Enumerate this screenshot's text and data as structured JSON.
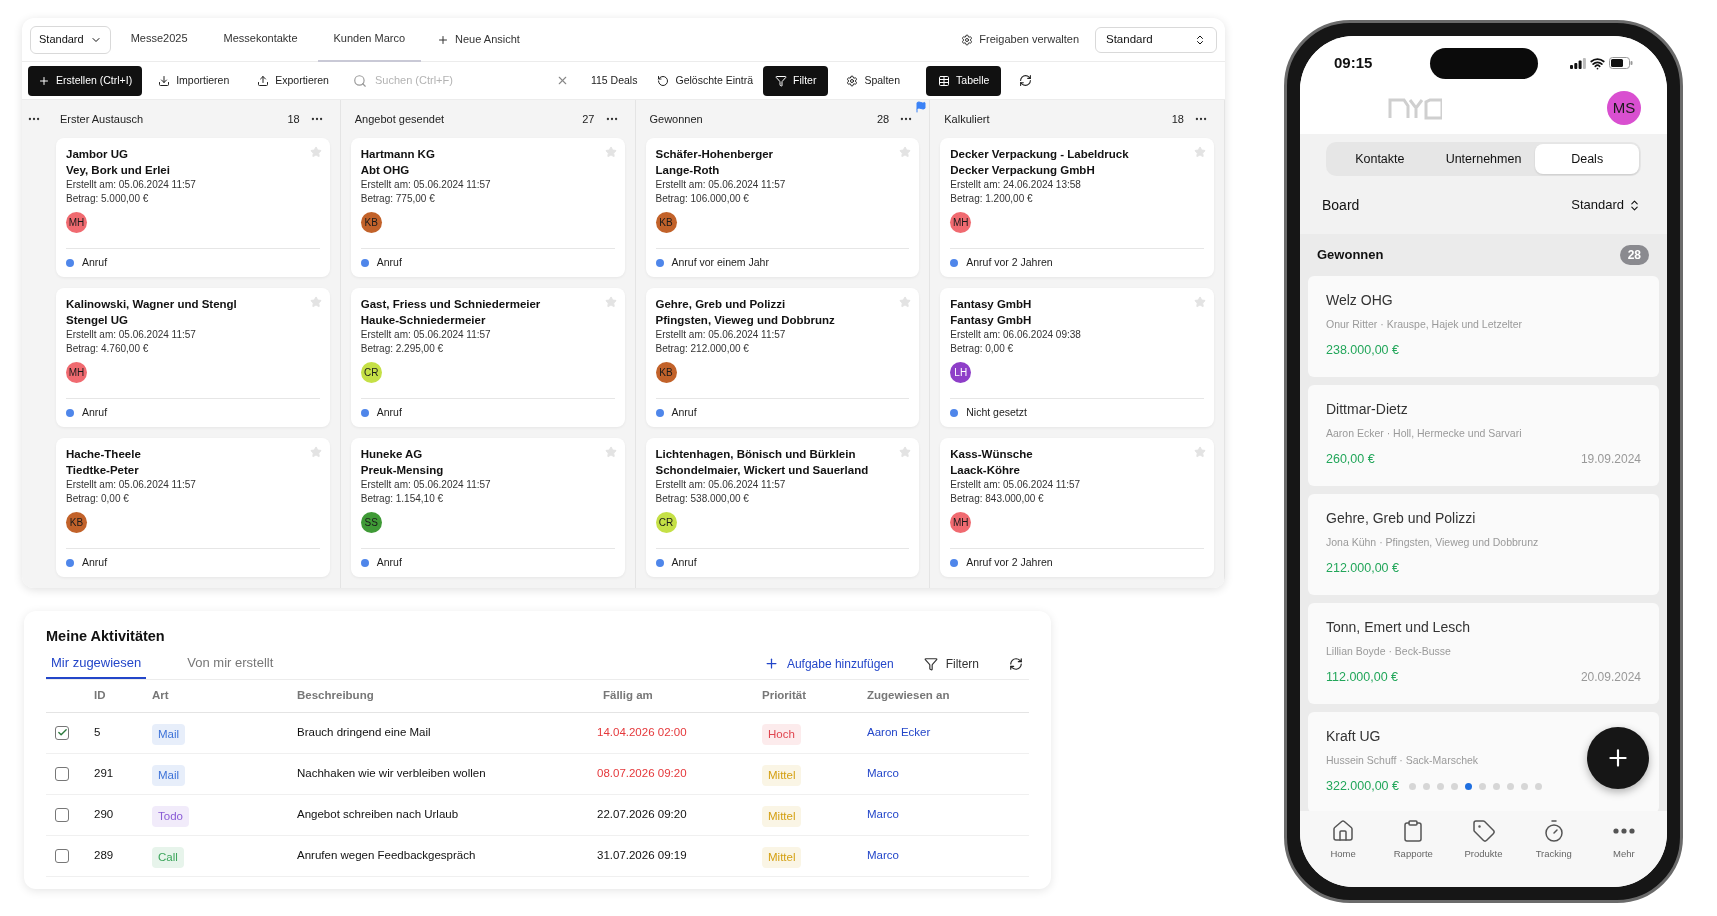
{
  "desktop": {
    "view_select": "Standard",
    "view_tabs": [
      {
        "label": "Messe2025",
        "selected": false
      },
      {
        "label": "Messekontakte",
        "selected": false
      },
      {
        "label": "Kunden Marco",
        "selected": true
      }
    ],
    "new_view": "Neue Ansicht",
    "share": "Freigaben verwalten",
    "view_dropdown": "Standard",
    "toolbar": {
      "create": "Erstellen (Ctrl+I)",
      "import": "Importieren",
      "export": "Exportieren",
      "search_placeholder": "Suchen (Ctrl+F)",
      "count": "115 Deals",
      "deleted": "Gelöschte Einträ",
      "filter": "Filter",
      "columns": "Spalten",
      "table": "Tabelle"
    },
    "columns": [
      {
        "title": "Erster Austausch",
        "count": "18",
        "flagged": false,
        "cards": [
          {
            "title": "Jambor UG",
            "company": "Vey, Bork und Erlei",
            "created": "Erstellt am: 05.06.2024 11:57",
            "amount": "Betrag: 5.000,00 €",
            "avatar": {
              "initials": "MH",
              "color": "#f06a70"
            },
            "activity": "Anruf"
          },
          {
            "title": "Kalinowski, Wagner und Stengl",
            "company": "Stengel UG",
            "created": "Erstellt am: 05.06.2024 11:57",
            "amount": "Betrag: 4.760,00 €",
            "avatar": {
              "initials": "MH",
              "color": "#f06a70"
            },
            "activity": "Anruf"
          },
          {
            "title": "Hache-Theele",
            "company": "Tiedtke-Peter",
            "created": "Erstellt am: 05.06.2024 11:57",
            "amount": "Betrag: 0,00 €",
            "avatar": {
              "initials": "KB",
              "color": "#c2622a"
            },
            "activity": "Anruf"
          }
        ]
      },
      {
        "title": "Angebot gesendet",
        "count": "27",
        "flagged": false,
        "cards": [
          {
            "title": "Hartmann KG",
            "company": "Abt OHG",
            "created": "Erstellt am: 05.06.2024 11:57",
            "amount": "Betrag: 775,00 €",
            "avatar": {
              "initials": "KB",
              "color": "#c2622a"
            },
            "activity": "Anruf"
          },
          {
            "title": "Gast, Friess und Schniedermeier",
            "company": "Hauke-Schniedermeier",
            "created": "Erstellt am: 05.06.2024 11:57",
            "amount": "Betrag: 2.295,00 €",
            "avatar": {
              "initials": "CR",
              "color": "#c5e046"
            },
            "activity": "Anruf"
          },
          {
            "title": "Huneke AG",
            "company": "Preuk-Mensing",
            "created": "Erstellt am: 05.06.2024 11:57",
            "amount": "Betrag: 1.154,10 €",
            "avatar": {
              "initials": "SS",
              "color": "#3f9a36"
            },
            "activity": "Anruf"
          }
        ]
      },
      {
        "title": "Gewonnen",
        "count": "28",
        "flagged": true,
        "cards": [
          {
            "title": "Schäfer-Hohenberger",
            "company": "Lange-Roth",
            "created": "Erstellt am: 05.06.2024 11:57",
            "amount": "Betrag: 106.000,00 €",
            "avatar": {
              "initials": "KB",
              "color": "#c2622a"
            },
            "activity": "Anruf vor einem Jahr"
          },
          {
            "title": "Gehre, Greb und Polizzi",
            "company": "Pfingsten, Vieweg und Dobbrunz",
            "created": "Erstellt am: 05.06.2024 11:57",
            "amount": "Betrag: 212.000,00 €",
            "avatar": {
              "initials": "KB",
              "color": "#c2622a"
            },
            "activity": "Anruf"
          },
          {
            "title": "Lichtenhagen, Bönisch und Bürklein",
            "company": "Schondelmaier, Wickert und Sauerland",
            "created": "Erstellt am: 05.06.2024 11:57",
            "amount": "Betrag: 538.000,00 €",
            "avatar": {
              "initials": "CR",
              "color": "#c5e046"
            },
            "activity": "Anruf"
          }
        ]
      },
      {
        "title": "Kalkuliert",
        "count": "18",
        "flagged": false,
        "cards": [
          {
            "title": "Decker Verpackung - Labeldruck",
            "company": "Decker Verpackung GmbH",
            "created": "Erstellt am: 24.06.2024 13:58",
            "amount": "Betrag: 1.200,00 €",
            "avatar": {
              "initials": "MH",
              "color": "#f06a70"
            },
            "activity": "Anruf vor 2 Jahren"
          },
          {
            "title": "Fantasy GmbH",
            "company": "Fantasy GmbH",
            "created": "Erstellt am: 06.06.2024 09:38",
            "amount": "Betrag: 0,00 €",
            "avatar": {
              "initials": "LH",
              "color": "#8e3ec8"
            },
            "activity": "Nicht gesetzt"
          },
          {
            "title": "Kass-Wünsche",
            "company": "Laack-Köhre",
            "created": "Erstellt am: 05.06.2024 11:57",
            "amount": "Betrag: 843.000,00 €",
            "avatar": {
              "initials": "MH",
              "color": "#f06a70"
            },
            "activity": "Anruf vor 2 Jahren"
          }
        ]
      }
    ]
  },
  "activities": {
    "title": "Meine Aktivitäten",
    "tabs": [
      {
        "label": "Mir zugewiesen",
        "selected": true
      },
      {
        "label": "Von mir erstellt",
        "selected": false
      }
    ],
    "add_task": "Aufgabe hinzufügen",
    "filter": "Filtern",
    "columns": [
      "ID",
      "Art",
      "Beschreibung",
      "Fällig am",
      "Priorität",
      "Zugewiesen an"
    ],
    "rows": [
      {
        "checked": true,
        "id": "5",
        "type": {
          "label": "Mail",
          "color": "#3d72d8"
        },
        "description": "Brauch dringend eine Mail",
        "due": "14.04.2026 02:00",
        "overdue": true,
        "priority": {
          "label": "Hoch",
          "color": "#e0454f"
        },
        "assignee": "Aaron Ecker"
      },
      {
        "checked": false,
        "id": "291",
        "type": {
          "label": "Mail",
          "color": "#3d72d8"
        },
        "description": "Nachhaken wie wir verbleiben wollen",
        "due": "08.07.2026 09:20",
        "overdue": true,
        "priority": {
          "label": "Mittel",
          "color": "#d4a012"
        },
        "assignee": "Marco"
      },
      {
        "checked": false,
        "id": "290",
        "type": {
          "label": "Todo",
          "color": "#8a5cd6"
        },
        "description": "Angebot schreiben nach Urlaub",
        "due": "22.07.2026 09:20",
        "overdue": false,
        "priority": {
          "label": "Mittel",
          "color": "#d4a012"
        },
        "assignee": "Marco"
      },
      {
        "checked": false,
        "id": "289",
        "type": {
          "label": "Call",
          "color": "#3aa55a"
        },
        "description": "Anrufen wegen Feedbackgespräch",
        "due": "31.07.2026 09:19",
        "overdue": false,
        "priority": {
          "label": "Mittel",
          "color": "#d4a012"
        },
        "assignee": "Marco"
      }
    ]
  },
  "phone": {
    "time": "09:15",
    "avatar": {
      "initials": "MS",
      "color": "#d94fd0"
    },
    "segments": [
      {
        "label": "Kontakte",
        "selected": false
      },
      {
        "label": "Unternehmen",
        "selected": false
      },
      {
        "label": "Deals",
        "selected": true
      }
    ],
    "board_label": "Board",
    "board_view": "Standard",
    "section": {
      "title": "Gewonnen",
      "count": "28"
    },
    "deals": [
      {
        "title": "Welz OHG",
        "subtitle": "Onur Ritter · Krauspe, Hajek und Letzelter",
        "amount": "238.000,00 €"
      },
      {
        "title": "Dittmar-Dietz",
        "subtitle": "Aaron Ecker · Holl, Hermecke und Sarvari",
        "amount": "260,00 €",
        "date": "19.09.2024"
      },
      {
        "title": "Gehre, Greb und Polizzi",
        "subtitle": "Jona Kühn · Pfingsten, Vieweg und Dobbrunz",
        "amount": "212.000,00 €"
      },
      {
        "title": "Tonn, Emert und Lesch",
        "subtitle": "Lillian Boyde · Beck-Busse",
        "amount": "112.000,00 €",
        "date": "20.09.2024"
      },
      {
        "title": "Kraft UG",
        "subtitle": "Hussein Schuff · Sack-Marschek",
        "amount": "322.000,00 €",
        "page_dots": [
          {
            "selected": false
          },
          {
            "selected": false
          },
          {
            "selected": false
          },
          {
            "selected": false
          },
          {
            "selected": true
          },
          {
            "selected": false
          },
          {
            "selected": false
          },
          {
            "selected": false
          },
          {
            "selected": false
          },
          {
            "selected": false
          }
        ]
      }
    ],
    "nav": [
      {
        "label": "Home",
        "kind": "home"
      },
      {
        "label": "Rapporte",
        "kind": "reports"
      },
      {
        "label": "Produkte",
        "kind": "products"
      },
      {
        "label": "Tracking",
        "kind": "tracking"
      },
      {
        "label": "Mehr",
        "kind": "more"
      }
    ]
  }
}
